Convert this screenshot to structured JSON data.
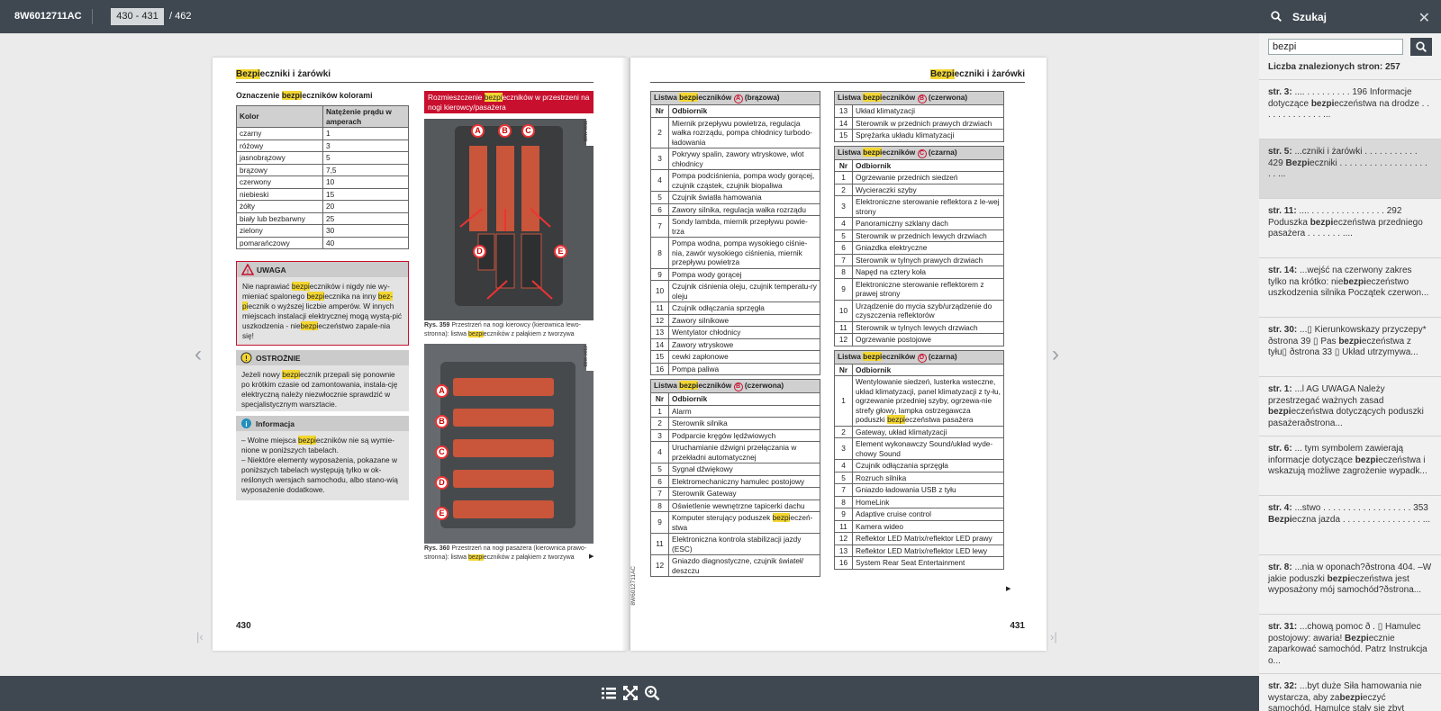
{
  "topbar": {
    "doc_id": "8W6012711AC",
    "page_range": "430 - 431",
    "page_total": "/ 462"
  },
  "search": {
    "title": "Szukaj",
    "query": "bezpi",
    "count_label": "Liczba znalezionych stron: 257",
    "results": [
      {
        "page": "str. 3:",
        "pre": " .... . . . . . . . . . 196 Informacje dotyczące ",
        "hit": "bezpi",
        "post": "eczeństwa na drodze . . . . . . . . . . . . . ..."
      },
      {
        "page": "str. 5:",
        "pre": " ...czniki i żarówki . . . . . . . . . . . 429 ",
        "hit": "Bezpi",
        "post": "eczniki . . . . . . . . . . . . . . . . . . . . ..."
      },
      {
        "page": "str. 11:",
        "pre": " .... . . . . . . . . . . . . . . . 292 Poduszka ",
        "hit": "bezpi",
        "post": "eczeństwa przedniego pasażera . . . . . . . ...."
      },
      {
        "page": "str. 14:",
        "pre": " ...wejść na czerwony zakres tylko na krótko: nie",
        "hit": "bezpi",
        "post": "eczeństwo uszkodzenia silnika Początek czerwon..."
      },
      {
        "page": "str. 30:",
        "pre": " ...▯ Kierunkowskazy przyczepy* ðstrona 39 ▯ Pas ",
        "hit": "bezpi",
        "post": "eczeństwa z tyłu▯ ðstrona 33 ▯ Układ utrzymywa..."
      },
      {
        "page": "str. 1:",
        "pre": " ...l AG UWAGA Należy przestrzegać ważnych zasad ",
        "hit": "bezpi",
        "post": "eczeństwa dotyczących poduszki pasażeraðstrona..."
      },
      {
        "page": "str. 6:",
        "pre": " ... tym symbolem zawierają informacje dotyczące ",
        "hit": "bezpi",
        "post": "eczeństwa i wskazują możliwe zagrożenie wypadk..."
      },
      {
        "page": "str. 4:",
        "pre": " ...stwo . . . . . . . . . . . . . . . . . . 353 ",
        "hit": "Bezpi",
        "post": "eczna jazda . . . . . . . . . . . . . . . . ..."
      },
      {
        "page": "str. 8:",
        "pre": " ...nia w oponach?ðstrona 404. –W jakie poduszki ",
        "hit": "bezpi",
        "post": "eczeństwa jest wyposażony mój samochód?ðstrona..."
      },
      {
        "page": "str. 31:",
        "pre": " ...chową pomoc ð . ▯ Hamulec postojowy: awaria! ",
        "hit": "Bezpi",
        "post": "ecznie zaparkować samochód. Patrz Instrukcja o..."
      },
      {
        "page": "str. 32:",
        "pre": " ...byt duże Siła hamowania nie wystarcza, aby za",
        "hit": "bezpi",
        "post": "eczyć samochód. Hamulce stały się zbyt gorące...."
      }
    ]
  },
  "left_page": {
    "chapter_hl": "Bezpi",
    "chapter_rest": "eczniki i żarówki",
    "page_number": "430",
    "color_title_pre": "Oznaczenie ",
    "color_title_hl": "bezpi",
    "color_title_post": "eczników kolorami",
    "color_head": [
      "Kolor",
      "Natężenie prądu w amperach"
    ],
    "colors": [
      [
        "czarny",
        "1"
      ],
      [
        "różowy",
        "3"
      ],
      [
        "jasnobrązowy",
        "5"
      ],
      [
        "brązowy",
        "7,5"
      ],
      [
        "czerwony",
        "10"
      ],
      [
        "niebieski",
        "15"
      ],
      [
        "żółty",
        "20"
      ],
      [
        "biały lub bezbarwny",
        "25"
      ],
      [
        "zielony",
        "30"
      ],
      [
        "pomarańczowy",
        "40"
      ]
    ],
    "warn_title": "UWAGA",
    "warn_text": [
      "Nie naprawiać ",
      "bezpi",
      "eczników i nigdy nie wy-mieniać spalonego ",
      "bezpi",
      "ecznika na inny ",
      "bez-pi",
      "ecznik o wyższej liczbie amperów. W innych miejscach instalacji elektrycznej mogą wystą-pić uszkodzenia - nie",
      "bezpi",
      "eczeństwo zapale-nia się!"
    ],
    "caution_title": "OSTROŻNIE",
    "caution_text": [
      "Jeżeli nowy ",
      "bezpi",
      "ecznik przepali się ponownie po krótkim czasie od zamontowania, instala-cję elektryczną należy niezwłocznie sprawdzić w specjalistycznym warsztacie."
    ],
    "info_title": "Informacja",
    "info_items": [
      [
        "– Wolne miejsca ",
        "bezpi",
        "eczników nie są wymie-nione w poniższych tabelach."
      ],
      [
        "– Niektóre elementy wyposażenia, pokazane w poniższych tabelach występują tylko w ok-reślonych wersjach samochodu, albo stano-wią wyposażenie dodatkowe.",
        "",
        ""
      ]
    ],
    "fig_title_pre": "Rozmieszczenie ",
    "fig_title_hl": "bezpi",
    "fig_title_post": "eczników w przestrzeni na nogi kierowcy/pasażera",
    "fig1_code": "B8W-0011",
    "fig2_code": "B8W-0012",
    "cap1": [
      "Rys. 359",
      "  Przestrzeń na nogi kierowcy (kierownica lewo-stronna): listwa ",
      "bezpi",
      "eczników z pałąkiem z tworzywa"
    ],
    "cap2": [
      "Rys. 360",
      "  Przestrzeń na nogi pasażera (kierownica prawo-stronna): listwa ",
      "bezpi",
      "eczników z pałąkiem z tworzywa"
    ],
    "fuse_letters_1": [
      "A",
      "B",
      "C",
      "D",
      "E"
    ],
    "fuse_letters_2": [
      "A",
      "B",
      "C",
      "D",
      "E"
    ]
  },
  "right_page": {
    "chapter_hl": "Bezpi",
    "chapter_rest": "eczniki i żarówki",
    "page_number": "431",
    "side_code": "8W6012711AC",
    "col_nr": "Nr",
    "col_recv": "Odbiornik",
    "tables_left": [
      {
        "pre": "Listwa ",
        "hl": "bezpi",
        "mid": "eczników ",
        "letter": "A",
        "suffix": " (brązowa)",
        "rows": [
          [
            "2",
            "Miernik przepływu powietrza, regulacja wałka rozrządu, pompa chłodnicy turbodo-ładowania"
          ],
          [
            "3",
            "Pokrywy spalin, zawory wtryskowe, wlot chłodnicy"
          ],
          [
            "4",
            "Pompa podciśnienia, pompa wody gorącej, czujnik cząstek, czujnik biopaliwa"
          ],
          [
            "5",
            "Czujnik światła hamowania"
          ],
          [
            "6",
            "Zawory silnika, regulacja wałka rozrządu"
          ],
          [
            "7",
            "Sondy lambda, miernik przepływu powie-trza"
          ],
          [
            "8",
            "Pompa wodna, pompa wysokiego ciśnie-nia, zawór wysokiego ciśnienia, miernik przepływu powietrza"
          ],
          [
            "9",
            "Pompa wody gorącej"
          ],
          [
            "10",
            "Czujnik ciśnienia oleju, czujnik temperatu-ry oleju"
          ],
          [
            "11",
            "Czujnik odłączania sprzęgła"
          ],
          [
            "12",
            "Zawory silnikowe"
          ],
          [
            "13",
            "Wentylator chłodnicy"
          ],
          [
            "14",
            "Zawory wtryskowe"
          ],
          [
            "15",
            "cewki zapłonowe"
          ],
          [
            "16",
            "Pompa paliwa"
          ]
        ]
      },
      {
        "pre": "Listwa ",
        "hl": "bezpi",
        "mid": "eczników ",
        "letter": "B",
        "suffix": " (czerwona)",
        "rows": [
          [
            "1",
            "Alarm"
          ],
          [
            "2",
            "Sterownik silnika"
          ],
          [
            "3",
            "Podparcie kręgów lędźwiowych"
          ],
          [
            "4",
            "Uruchamianie dźwigni przełączania w przekładni automatycznej"
          ],
          [
            "5",
            "Sygnał dźwiękowy"
          ],
          [
            "6",
            "Elektromechaniczny hamulec postojowy"
          ],
          [
            "7",
            "Sterownik Gateway"
          ],
          [
            "8",
            "Oświetlenie wewnętrzne tapicerki dachu"
          ],
          [
            "9",
            "Komputer sterujący poduszek |bezpi|eczeń-stwa"
          ],
          [
            "11",
            "Elektroniczna kontrola stabilizacji jazdy (ESC)"
          ],
          [
            "12",
            "Gniazdo diagnostyczne, czujnik świateł/ deszczu"
          ]
        ]
      }
    ],
    "tables_right": [
      {
        "pre": "Listwa ",
        "hl": "bezpi",
        "mid": "eczników ",
        "letter": "B",
        "suffix": " (czerwona)",
        "rows": [
          [
            "13",
            "Układ klimatyzacji"
          ],
          [
            "14",
            "Sterownik w przednich prawych drzwiach"
          ],
          [
            "15",
            "Sprężarka układu klimatyzacji"
          ]
        ],
        "no_header": true
      },
      {
        "pre": "Listwa ",
        "hl": "bezpi",
        "mid": "eczników ",
        "letter": "C",
        "suffix": " (czarna)",
        "rows": [
          [
            "1",
            "Ogrzewanie przednich siedzeń"
          ],
          [
            "2",
            "Wycieraczki szyby"
          ],
          [
            "3",
            "Elektroniczne sterowanie reflektora z le-wej strony"
          ],
          [
            "4",
            "Panoramiczny szklany dach"
          ],
          [
            "5",
            "Sterownik w przednich lewych drzwiach"
          ],
          [
            "6",
            "Gniazdka elektryczne"
          ],
          [
            "7",
            "Sterownik w tylnych prawych drzwiach"
          ],
          [
            "8",
            "Napęd na cztery koła"
          ],
          [
            "9",
            "Elektroniczne sterowanie reflektorem z prawej strony"
          ],
          [
            "10",
            "Urządzenie do mycia szyb/urządzenie do czyszczenia reflektorów"
          ],
          [
            "11",
            "Sterownik w tylnych lewych drzwiach"
          ],
          [
            "12",
            "Ogrzewanie postojowe"
          ]
        ]
      },
      {
        "pre": "Listwa ",
        "hl": "bezpi",
        "mid": "eczników ",
        "letter": "D",
        "suffix": " (czarna)",
        "rows": [
          [
            "1",
            "Wentylowanie siedzeń, lusterka wsteczne, układ klimatyzacji, panel klimatyzacji z ty-łu, ogrzewanie przedniej szyby, ogrzewa-nie strefy głowy, lampka ostrzegawcza poduszki |bezpi|eczeństwa pasażera"
          ],
          [
            "2",
            "Gateway, układ klimatyzacji"
          ],
          [
            "3",
            "Element wykonawczy Sound/układ wyde-chowy Sound"
          ],
          [
            "4",
            "Czujnik odłączania sprzęgła"
          ],
          [
            "5",
            "Rozruch silnika"
          ],
          [
            "7",
            "Gniazdo ładowania USB z tyłu"
          ],
          [
            "8",
            "HomeLink"
          ],
          [
            "9",
            "Adaptive cruise control"
          ],
          [
            "11",
            "Kamera wideo"
          ],
          [
            "12",
            "Reflektor LED Matrix/reflektor LED prawy"
          ],
          [
            "13",
            "Reflektor LED Matrix/reflektor LED lewy"
          ],
          [
            "16",
            "System Rear Seat Entertainment"
          ]
        ]
      }
    ]
  },
  "icons": {
    "search": "search-icon",
    "close": "close-icon",
    "toc": "list-icon",
    "fullscreen": "fullscreen-icon",
    "zoom": "zoom-in-icon"
  },
  "colors": {
    "topbar": "#3f4851",
    "highlight": "#f3d631",
    "accent_red": "#c8102e"
  }
}
